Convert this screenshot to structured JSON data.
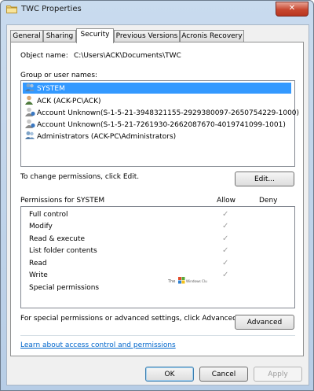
{
  "window": {
    "title": "TWC Properties",
    "close_glyph": "✕"
  },
  "tabs": [
    {
      "label": "General",
      "active": false
    },
    {
      "label": "Sharing",
      "active": false
    },
    {
      "label": "Security",
      "active": true
    },
    {
      "label": "Previous Versions",
      "active": false
    },
    {
      "label": "Acronis Recovery",
      "active": false
    }
  ],
  "object": {
    "label": "Object name:",
    "value": "C:\\Users\\ACK\\Documents\\TWC"
  },
  "groups": {
    "label": "Group or user names:",
    "items": [
      {
        "name": "SYSTEM",
        "icon": "users-icon",
        "selected": true
      },
      {
        "name": "ACK (ACK-PC\\ACK)",
        "icon": "user-icon",
        "selected": false
      },
      {
        "name": "Account Unknown(S-1-5-21-3948321155-2929380097-2650754229-1000)",
        "icon": "unknown-user-icon",
        "selected": false
      },
      {
        "name": "Account Unknown(S-1-5-21-7261930-2662087670-4019741099-1001)",
        "icon": "unknown-user-icon",
        "selected": false
      },
      {
        "name": "Administrators (ACK-PC\\Administrators)",
        "icon": "users-icon",
        "selected": false
      }
    ]
  },
  "change": {
    "text": "To change permissions, click Edit.",
    "button": "Edit..."
  },
  "permissions": {
    "title": "Permissions for SYSTEM",
    "allow_label": "Allow",
    "deny_label": "Deny",
    "rows": [
      {
        "name": "Full control",
        "allow": "✓",
        "deny": ""
      },
      {
        "name": "Modify",
        "allow": "✓",
        "deny": ""
      },
      {
        "name": "Read & execute",
        "allow": "✓",
        "deny": ""
      },
      {
        "name": "List folder contents",
        "allow": "✓",
        "deny": ""
      },
      {
        "name": "Read",
        "allow": "✓",
        "deny": ""
      },
      {
        "name": "Write",
        "allow": "✓",
        "deny": ""
      },
      {
        "name": "Special permissions",
        "allow": "",
        "deny": ""
      }
    ]
  },
  "watermark": {
    "line1": "The",
    "line2": "Windows Club"
  },
  "advanced": {
    "text": "For special permissions or advanced settings, click Advanced.",
    "button": "Advanced"
  },
  "help_link": "Learn about access control and permissions",
  "footer": {
    "ok": "OK",
    "cancel": "Cancel",
    "apply": "Apply"
  },
  "colors": {
    "selection": "#3399ff",
    "link": "#0066cc",
    "close": "#c7472f"
  }
}
